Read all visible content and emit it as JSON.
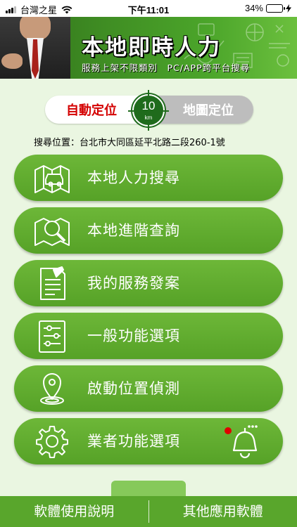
{
  "status_bar": {
    "carrier": "台灣之星",
    "time": "下午11:01",
    "battery_percent_label": "34%",
    "battery_level": 0.34
  },
  "banner": {
    "title": "本地即時人力",
    "subtitle": "服務上架不限類別　PC/APP跨平台搜尋"
  },
  "location_toggle": {
    "auto_label": "自動定位",
    "map_label": "地圖定位",
    "radius_value": "10",
    "radius_unit": "km",
    "selected": "auto"
  },
  "search_location": {
    "text": "搜尋位置：台北市大同區延平北路二段260-1號"
  },
  "menu": {
    "items": [
      {
        "label": "本地人力搜尋",
        "icon": "map-car-icon"
      },
      {
        "label": "本地進階查詢",
        "icon": "map-magnifier-icon"
      },
      {
        "label": "我的服務發案",
        "icon": "document-edit-icon"
      },
      {
        "label": "一般功能選項",
        "icon": "settings-sliders-icon"
      },
      {
        "label": "啟動位置偵測",
        "icon": "location-pin-icon"
      },
      {
        "label": "業者功能選項",
        "icon": "gear-icon"
      }
    ]
  },
  "bottom_tabs": {
    "help_label": "軟體使用說明",
    "other_apps_label": "其他應用軟體"
  },
  "colors": {
    "primary_green": "#5aa52a",
    "toggle_active_text": "#d40000",
    "background": "#eaf6e1"
  }
}
